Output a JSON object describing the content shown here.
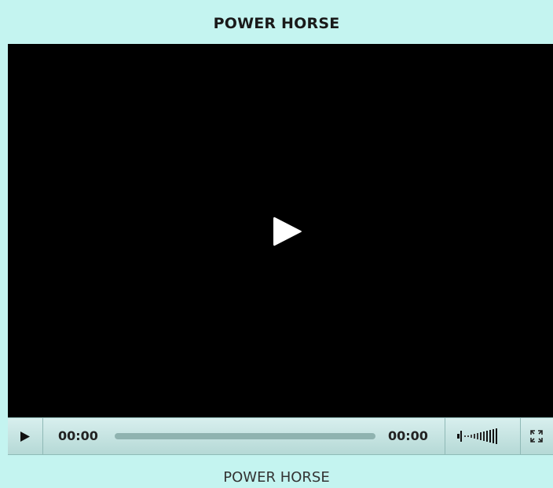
{
  "header": {
    "title": "POWER HORSE"
  },
  "player": {
    "big_play_icon": "play-icon",
    "controls": {
      "play_icon": "play-icon",
      "current_time": "00:00",
      "total_time": "00:00",
      "progress": 0,
      "volume_icon": "volume-icon",
      "fullscreen_icon": "fullscreen-icon"
    }
  },
  "caption": {
    "text": "POWER HORSE"
  },
  "colors": {
    "background": "#c4f4f0",
    "video": "#000000",
    "progress_track": "#8fb3b0"
  }
}
